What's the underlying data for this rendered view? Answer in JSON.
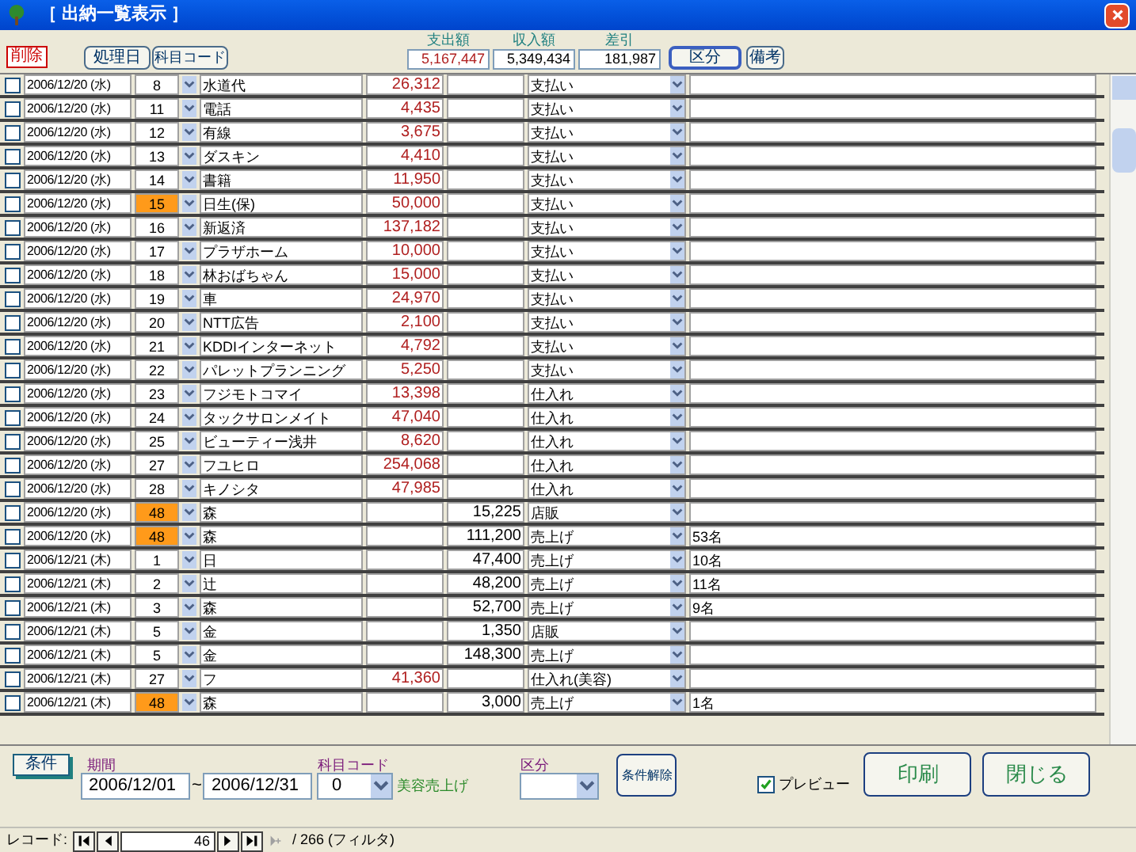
{
  "window": {
    "title": "［ 出納一覧表示 ］"
  },
  "header": {
    "delete_button": "削除",
    "sort_buttons": [
      "処理日",
      "科目コード"
    ],
    "totals": [
      {
        "label": "支出額",
        "value": "5,167,447",
        "kind": "expense"
      },
      {
        "label": "収入額",
        "value": "5,349,434",
        "kind": "income"
      },
      {
        "label": "差引",
        "value": "181,987",
        "kind": "balance"
      }
    ],
    "category_button": "区分",
    "remark_button": "備考"
  },
  "rows": [
    {
      "checked": false,
      "date": "2006/12/20 (水)",
      "code": "8",
      "flagged": false,
      "name": "水道代",
      "expense": "26,312",
      "income": "",
      "category": "支払い",
      "remark": ""
    },
    {
      "checked": false,
      "date": "2006/12/20 (水)",
      "code": "11",
      "flagged": false,
      "name": "電話",
      "expense": "4,435",
      "income": "",
      "category": "支払い",
      "remark": ""
    },
    {
      "checked": false,
      "date": "2006/12/20 (水)",
      "code": "12",
      "flagged": false,
      "name": "有線",
      "expense": "3,675",
      "income": "",
      "category": "支払い",
      "remark": ""
    },
    {
      "checked": false,
      "date": "2006/12/20 (水)",
      "code": "13",
      "flagged": false,
      "name": "ダスキン",
      "expense": "4,410",
      "income": "",
      "category": "支払い",
      "remark": ""
    },
    {
      "checked": false,
      "date": "2006/12/20 (水)",
      "code": "14",
      "flagged": false,
      "name": "書籍",
      "expense": "11,950",
      "income": "",
      "category": "支払い",
      "remark": ""
    },
    {
      "checked": false,
      "date": "2006/12/20 (水)",
      "code": "15",
      "flagged": true,
      "name": "日生(保)",
      "expense": "50,000",
      "income": "",
      "category": "支払い",
      "remark": ""
    },
    {
      "checked": false,
      "date": "2006/12/20 (水)",
      "code": "16",
      "flagged": false,
      "name": "新返済",
      "expense": "137,182",
      "income": "",
      "category": "支払い",
      "remark": ""
    },
    {
      "checked": false,
      "date": "2006/12/20 (水)",
      "code": "17",
      "flagged": false,
      "name": "プラザホーム",
      "expense": "10,000",
      "income": "",
      "category": "支払い",
      "remark": ""
    },
    {
      "checked": false,
      "date": "2006/12/20 (水)",
      "code": "18",
      "flagged": false,
      "name": "林おばちゃん",
      "expense": "15,000",
      "income": "",
      "category": "支払い",
      "remark": ""
    },
    {
      "checked": false,
      "date": "2006/12/20 (水)",
      "code": "19",
      "flagged": false,
      "name": "車",
      "expense": "24,970",
      "income": "",
      "category": "支払い",
      "remark": ""
    },
    {
      "checked": false,
      "date": "2006/12/20 (水)",
      "code": "20",
      "flagged": false,
      "name": "NTT広告",
      "expense": "2,100",
      "income": "",
      "category": "支払い",
      "remark": ""
    },
    {
      "checked": false,
      "date": "2006/12/20 (水)",
      "code": "21",
      "flagged": false,
      "name": "KDDIインターネット",
      "expense": "4,792",
      "income": "",
      "category": "支払い",
      "remark": ""
    },
    {
      "checked": false,
      "date": "2006/12/20 (水)",
      "code": "22",
      "flagged": false,
      "name": "パレットプランニング",
      "expense": "5,250",
      "income": "",
      "category": "支払い",
      "remark": ""
    },
    {
      "checked": false,
      "date": "2006/12/20 (水)",
      "code": "23",
      "flagged": false,
      "name": "フジモトコマイ",
      "expense": "13,398",
      "income": "",
      "category": "仕入れ",
      "remark": ""
    },
    {
      "checked": false,
      "date": "2006/12/20 (水)",
      "code": "24",
      "flagged": false,
      "name": "タックサロンメイト",
      "expense": "47,040",
      "income": "",
      "category": "仕入れ",
      "remark": ""
    },
    {
      "checked": false,
      "date": "2006/12/20 (水)",
      "code": "25",
      "flagged": false,
      "name": "ビューティー浅井",
      "expense": "8,620",
      "income": "",
      "category": "仕入れ",
      "remark": ""
    },
    {
      "checked": false,
      "date": "2006/12/20 (水)",
      "code": "27",
      "flagged": false,
      "name": "フユヒロ",
      "expense": "254,068",
      "income": "",
      "category": "仕入れ",
      "remark": ""
    },
    {
      "checked": false,
      "date": "2006/12/20 (水)",
      "code": "28",
      "flagged": false,
      "name": "キノシタ",
      "expense": "47,985",
      "income": "",
      "category": "仕入れ",
      "remark": ""
    },
    {
      "checked": false,
      "date": "2006/12/20 (水)",
      "code": "48",
      "flagged": true,
      "name": "森",
      "expense": "",
      "income": "15,225",
      "category": "店販",
      "remark": ""
    },
    {
      "checked": false,
      "date": "2006/12/20 (水)",
      "code": "48",
      "flagged": true,
      "name": "森",
      "expense": "",
      "income": "111,200",
      "category": "売上げ",
      "remark": "53名"
    },
    {
      "checked": false,
      "date": "2006/12/21 (木)",
      "code": "1",
      "flagged": false,
      "name": "日",
      "expense": "",
      "income": "47,400",
      "category": "売上げ",
      "remark": "10名"
    },
    {
      "checked": false,
      "date": "2006/12/21 (木)",
      "code": "2",
      "flagged": false,
      "name": "辻",
      "expense": "",
      "income": "48,200",
      "category": "売上げ",
      "remark": "11名"
    },
    {
      "checked": false,
      "date": "2006/12/21 (木)",
      "code": "3",
      "flagged": false,
      "name": "森",
      "expense": "",
      "income": "52,700",
      "category": "売上げ",
      "remark": "9名"
    },
    {
      "checked": false,
      "date": "2006/12/21 (木)",
      "code": "5",
      "flagged": false,
      "name": "金",
      "expense": "",
      "income": "1,350",
      "category": "店販",
      "remark": ""
    },
    {
      "checked": false,
      "date": "2006/12/21 (木)",
      "code": "5",
      "flagged": false,
      "name": "金",
      "expense": "",
      "income": "148,300",
      "category": "売上げ",
      "remark": ""
    },
    {
      "checked": false,
      "date": "2006/12/21 (木)",
      "code": "27",
      "flagged": false,
      "name": "フ",
      "expense": "41,360",
      "income": "",
      "category": "仕入れ(美容)",
      "remark": ""
    },
    {
      "checked": false,
      "date": "2006/12/21 (木)",
      "code": "48",
      "flagged": true,
      "name": "森",
      "expense": "",
      "income": "3,000",
      "category": "売上げ",
      "remark": "1名"
    }
  ],
  "filter": {
    "button": "条件",
    "period_label": "期間",
    "date_from": "2006/12/01",
    "separator": "~",
    "date_to": "2006/12/31",
    "code_label": "科目コード",
    "code_value": "0",
    "code_name": "美容売上げ",
    "category_label": "区分",
    "clear_button": "条件解除",
    "preview_label": "プレビュー",
    "preview_checked": true,
    "print_button": "印刷",
    "close_button": "閉じる"
  },
  "record_nav": {
    "label": "レコード:",
    "current": "46",
    "total": "/ 266 (フィルタ)"
  }
}
